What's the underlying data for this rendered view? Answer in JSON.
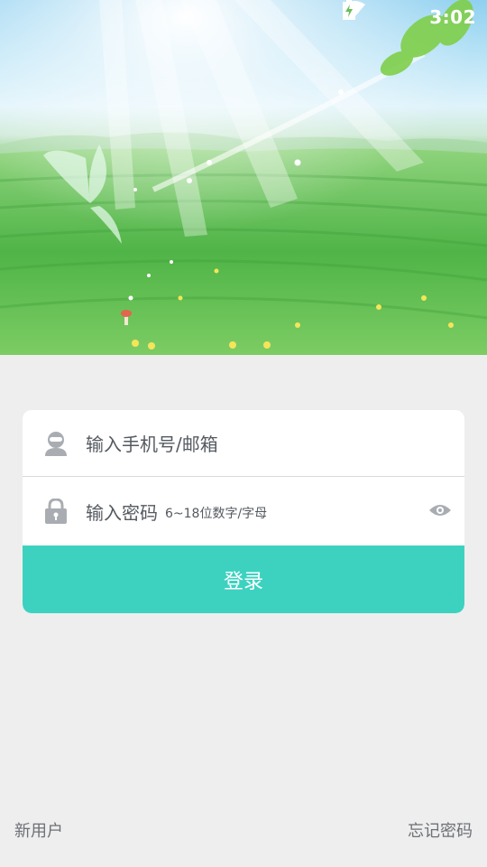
{
  "status_bar": {
    "time": "3:02",
    "wifi_icon": "wifi-icon",
    "battery_icon": "battery-charging-icon"
  },
  "login": {
    "account_placeholder": "输入手机号/邮箱",
    "password_placeholder": "输入密码",
    "password_hint": "6~18位数字/字母",
    "login_label": "登录",
    "user_icon": "user-icon",
    "lock_icon": "lock-icon",
    "eye_icon": "eye-icon"
  },
  "footer": {
    "new_user": "新用户",
    "forgot_password": "忘记密码"
  },
  "colors": {
    "accent": "#3dd2c0",
    "background": "#eeeeee",
    "text_secondary": "#555a60"
  }
}
